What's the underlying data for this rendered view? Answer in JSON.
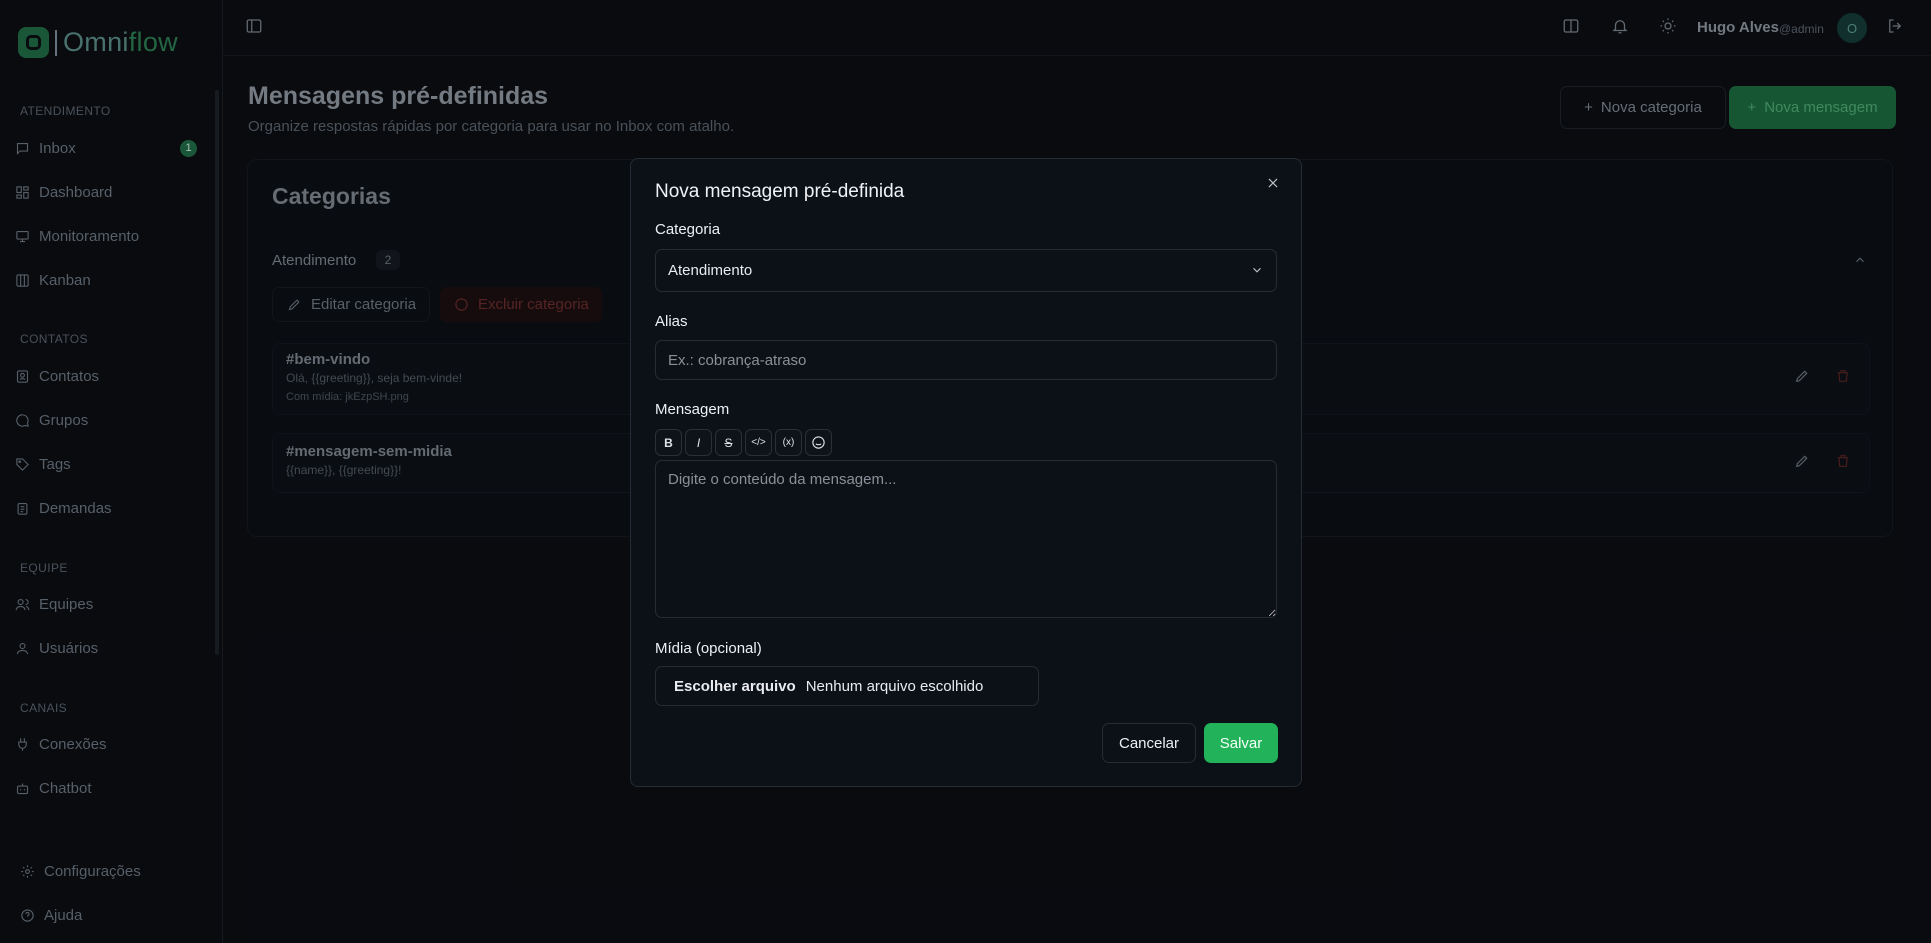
{
  "brand": {
    "logo_text_a": "Omni",
    "logo_text_b": "flow"
  },
  "sidebar": {
    "sections": [
      "ATENDIMENTO",
      "CONTATOS",
      "EQUIPE",
      "CANAIS"
    ],
    "items": [
      {
        "label": "Inbox",
        "icon": "message-square-icon",
        "badge": "1"
      },
      {
        "label": "Dashboard",
        "icon": "layout-dashboard-icon"
      },
      {
        "label": "Monitoramento",
        "icon": "monitor-icon"
      },
      {
        "label": "Kanban",
        "icon": "kanban-icon"
      },
      {
        "label": "Contatos",
        "icon": "contact-icon"
      },
      {
        "label": "Grupos",
        "icon": "chat-bubble-icon"
      },
      {
        "label": "Tags",
        "icon": "tag-icon"
      },
      {
        "label": "Demandas",
        "icon": "clipboard-icon"
      },
      {
        "label": "Equipes",
        "icon": "users-icon"
      },
      {
        "label": "Usuários",
        "icon": "user-icon"
      },
      {
        "label": "Conexões",
        "icon": "plug-icon"
      },
      {
        "label": "Chatbot",
        "icon": "bot-icon"
      }
    ],
    "footer": [
      {
        "label": "Configurações",
        "icon": "gear-icon"
      },
      {
        "label": "Ajuda",
        "icon": "help-circle-icon"
      }
    ]
  },
  "header": {
    "user_name": "Hugo Alves",
    "user_handle": "@admin",
    "avatar_initial": "O"
  },
  "page": {
    "title": "Mensagens pré-definidas",
    "subtitle": "Organize respostas rápidas por categoria para usar no Inbox com atalho.",
    "new_category_label": "Nova categoria",
    "new_message_label": "Nova mensagem"
  },
  "categories_card": {
    "title": "Categorias",
    "category": {
      "name": "Atendimento",
      "count": "2"
    },
    "edit_label": "Editar categoria",
    "delete_label": "Excluir categoria",
    "messages": [
      {
        "alias": "#bem-vindo",
        "text": "Olá, {{greeting}}, seja bem-vinde!",
        "media": "Com mídia: jkEzpSH.png"
      },
      {
        "alias": "#mensagem-sem-midia",
        "text": "{{name}}, {{greeting}}!",
        "media": ""
      }
    ]
  },
  "modal": {
    "title": "Nova mensagem pré-definida",
    "category_label": "Categoria",
    "category_value": "Atendimento",
    "alias_label": "Alias",
    "alias_placeholder": "Ex.: cobrança-atraso",
    "alias_value": "",
    "message_label": "Mensagem",
    "message_placeholder": "Digite o conteúdo da mensagem...",
    "message_value": "",
    "toolbar": [
      "B",
      "I",
      "S",
      "</>",
      "(x)",
      "emoji"
    ],
    "media_label": "Mídia (opcional)",
    "file_button_label": "Escolher arquivo",
    "file_status": "Nenhum arquivo escolhido",
    "cancel_label": "Cancelar",
    "save_label": "Salvar"
  },
  "colors": {
    "accent": "#22b35a",
    "background": "#0b0e13",
    "modal_bg": "#0c1118",
    "danger": "#6a2c2c"
  }
}
